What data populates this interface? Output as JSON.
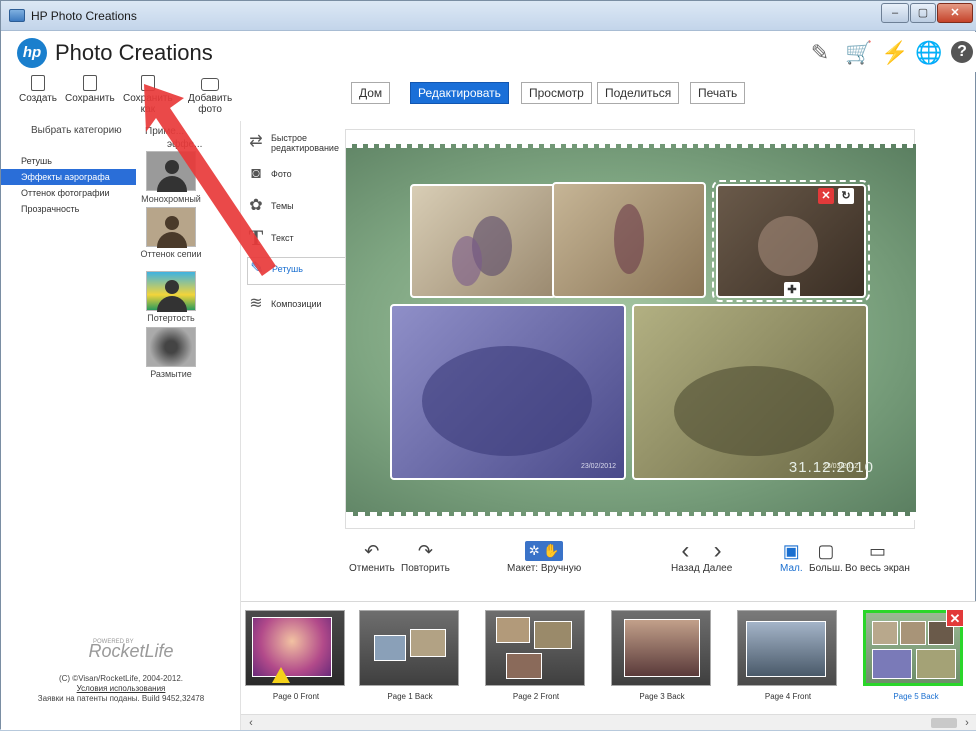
{
  "window": {
    "title": "HP Photo Creations",
    "btn_min": "–",
    "btn_max": "▢",
    "btn_close": "✕"
  },
  "header": {
    "logo_text": "hp",
    "brand": "Photo Creations",
    "help": "?",
    "icons": [
      "tag-icon",
      "cart-icon",
      "lightning-icon",
      "globe-icon",
      "help-icon"
    ],
    "glyphs": [
      "✎",
      "🛒",
      "⚡",
      "🌐"
    ]
  },
  "toolbar": {
    "create": "Создать",
    "save": "Сохранить",
    "save_as_1": "Сохранить",
    "save_as_2": "как",
    "add_photo_1": "Добавить",
    "add_photo_2": "фото"
  },
  "left": {
    "category_head": "Выбрать категорию",
    "effects_head_1": "Приме...",
    "effects_head_2": "эффе...",
    "categories": [
      {
        "label": "Ретушь",
        "active": false
      },
      {
        "label": "Эффекты аэрографа",
        "active": true
      },
      {
        "label": "Оттенок фотографии",
        "active": false
      },
      {
        "label": "Прозрачность",
        "active": false
      }
    ],
    "effects": [
      {
        "label": "Монохромный"
      },
      {
        "label": "Оттенок сепии"
      },
      {
        "label": "Потертость"
      },
      {
        "label": "Размытие"
      }
    ],
    "footer_powered": "POWERED BY",
    "footer_brand": "RocketLife",
    "footer_copyright": "(C) ©Visan/RocketLife, 2004-2012.",
    "footer_terms": "Условия использования",
    "footer_patent": "Заявки на патенты поданы. Build 9452,32478"
  },
  "tools": [
    {
      "label_1": "Быстрое",
      "label_2": "редактирование",
      "icon": "shuffle-icon",
      "glyph": "⇄",
      "active": false
    },
    {
      "label_1": "Фото",
      "label_2": "",
      "icon": "camera-icon",
      "glyph": "◙",
      "active": false
    },
    {
      "label_1": "Темы",
      "label_2": "",
      "icon": "themes-icon",
      "glyph": "✿",
      "active": false
    },
    {
      "label_1": "Текст",
      "label_2": "",
      "icon": "text-icon",
      "glyph": "T",
      "active": false
    },
    {
      "label_1": "Ретушь",
      "label_2": "",
      "icon": "brush-icon",
      "glyph": "✎",
      "active": true
    },
    {
      "label_1": "Композиции",
      "label_2": "",
      "icon": "layers-icon",
      "glyph": "≋",
      "active": false
    }
  ],
  "tabs": [
    {
      "label": "Дом",
      "active": false
    },
    {
      "label": "Редактировать",
      "active": true
    },
    {
      "label": "Просмотр",
      "active": false
    },
    {
      "label": "Поделиться",
      "active": false
    },
    {
      "label": "Печать",
      "active": false
    }
  ],
  "canvas": {
    "date_stamp": "31.12.2010",
    "photo_date_1": "23/02/2012",
    "photo_date_2": "23/03/2012",
    "btn_close": "✕",
    "btn_rotate": "↻",
    "btn_move": "✚"
  },
  "controls": {
    "undo": "Отменить",
    "undo_glyph": "↶",
    "redo": "Повторить",
    "redo_glyph": "↷",
    "layout": "Макет: Вручную",
    "layout_glyph": "✲ ✋",
    "back": "Назад",
    "back_glyph": "‹",
    "next": "Далее",
    "next_glyph": "›",
    "small": "Мал.",
    "small_glyph": "▣",
    "large": "Больш.",
    "large_glyph": "▢",
    "fullscreen": "Во весь экран",
    "fullscreen_glyph": "▭"
  },
  "pages": [
    {
      "label": "Page 0 Front",
      "active": false
    },
    {
      "label": "Page 1 Back",
      "active": false
    },
    {
      "label": "Page 2 Front",
      "active": false
    },
    {
      "label": "Page 3 Back",
      "active": false
    },
    {
      "label": "Page 4 Front",
      "active": false
    },
    {
      "label": "Page 5 Back",
      "active": true
    }
  ],
  "scroll": {
    "left": "‹",
    "right": "›"
  },
  "colors": {
    "accent": "#1a6fd8",
    "selected_page": "#2ad62a",
    "annotation_arrow": "#e8393a"
  }
}
